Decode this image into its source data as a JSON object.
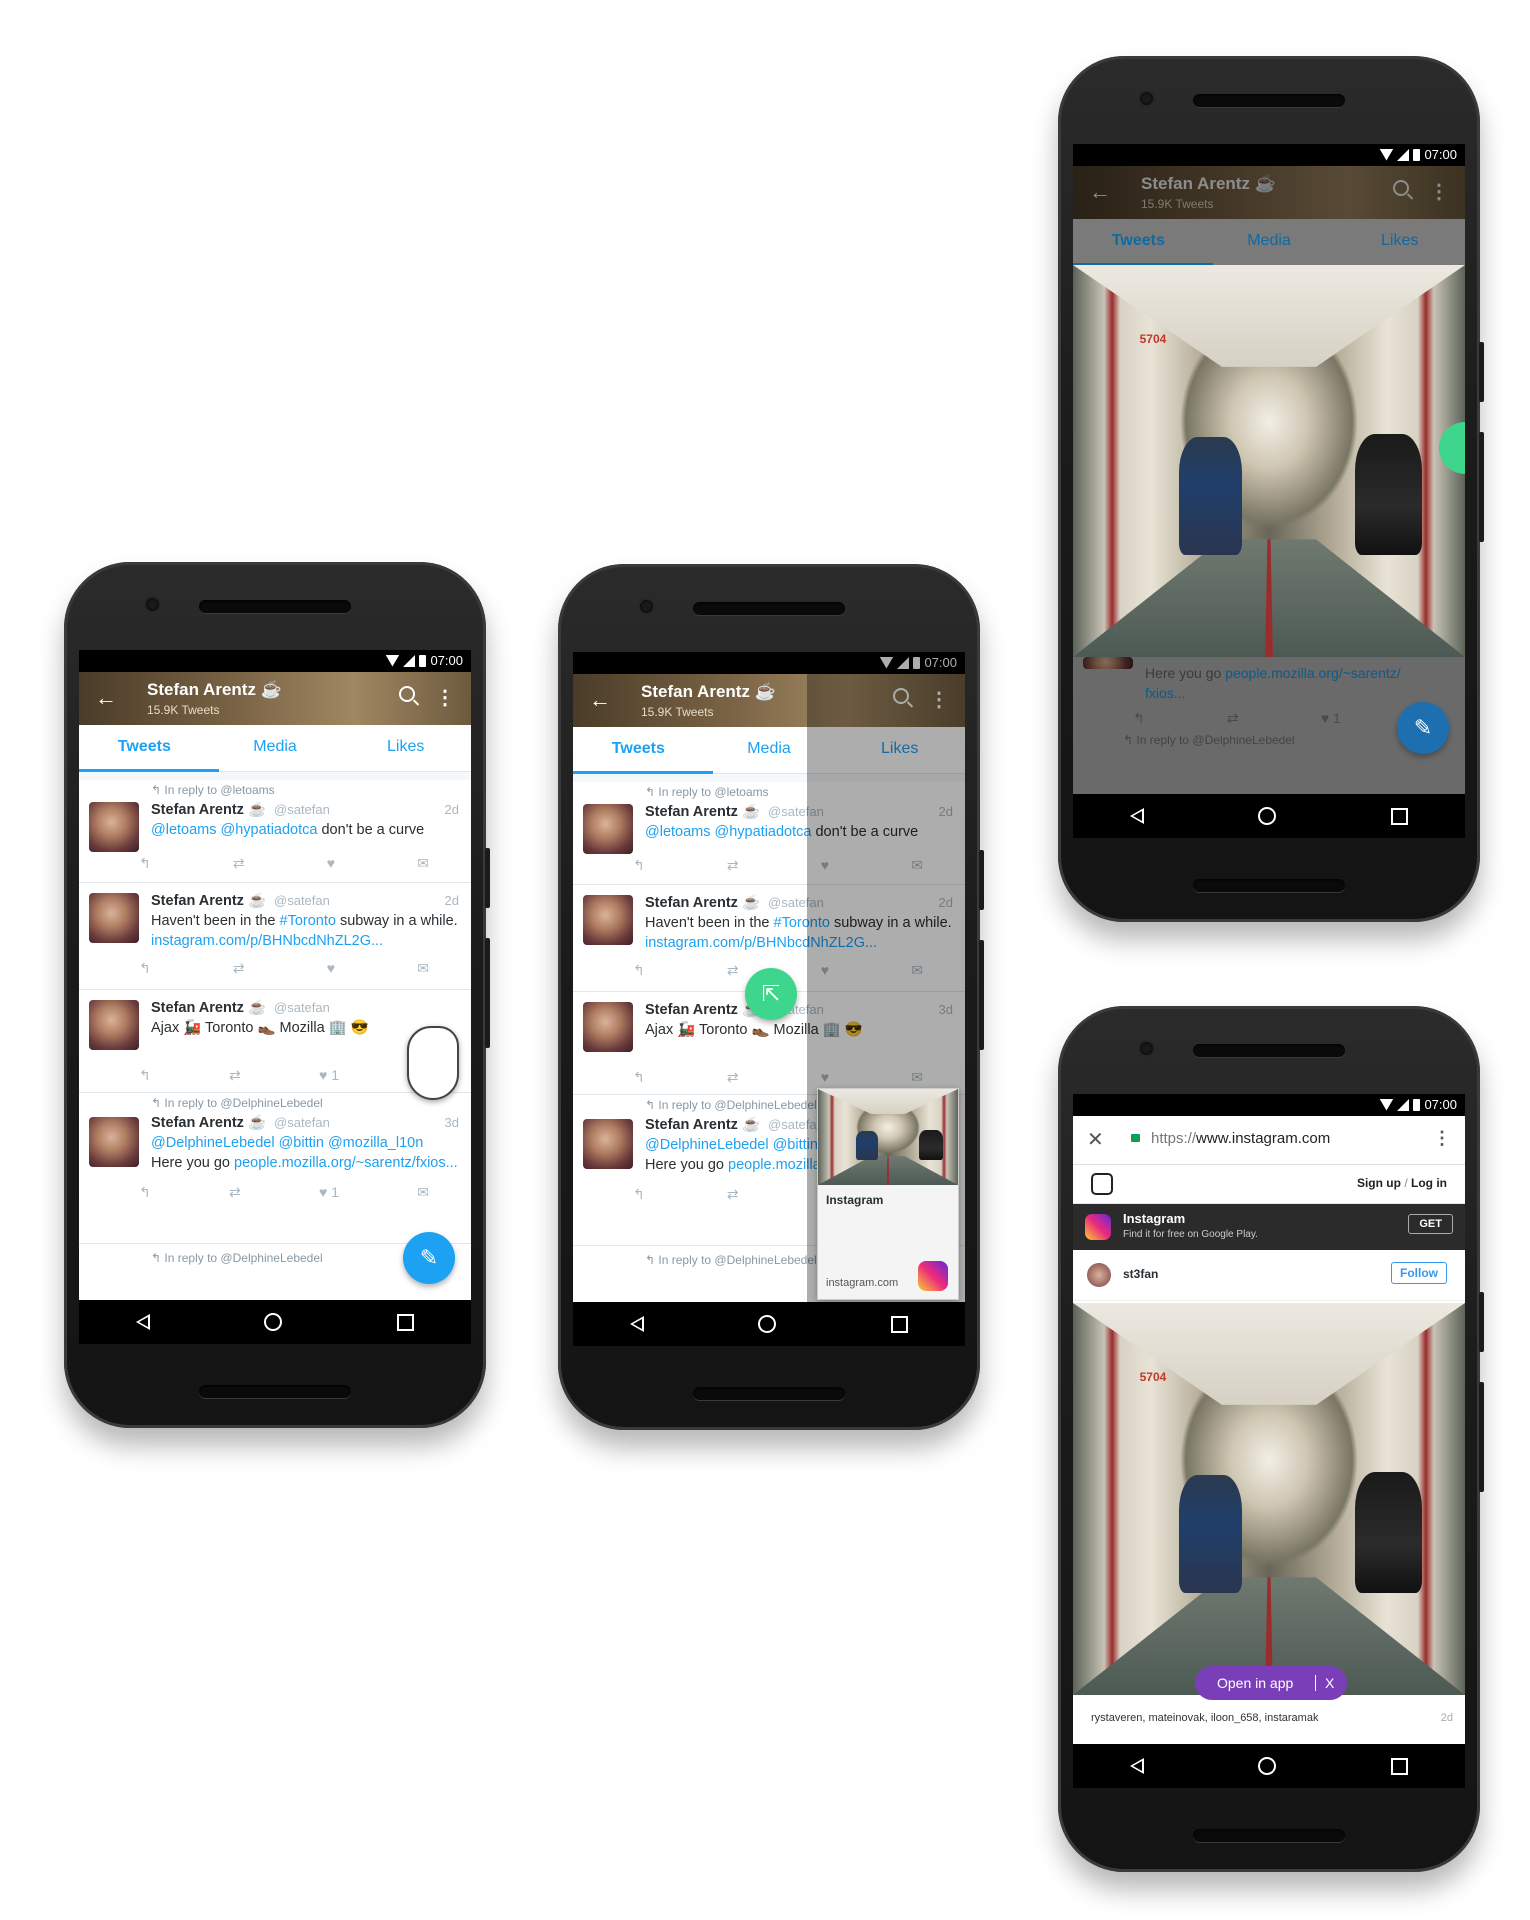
{
  "status": {
    "time": "07:00"
  },
  "profile": {
    "name": "Stefan Arentz ☕",
    "tweet_count": "15.9K Tweets",
    "tabs": [
      "Tweets",
      "Media",
      "Likes"
    ]
  },
  "tweets": [
    {
      "reply_to": "In reply to @letoams",
      "name": "Stefan Arentz ☕",
      "handle": "@satefan",
      "age": "2d",
      "text_links": "@letoams @hypatiadotca",
      "text": " don't be a curve"
    },
    {
      "reply_to": "",
      "name": "Stefan Arentz ☕",
      "handle": "@satefan",
      "age": "2d",
      "text_pre": "Haven't been in the ",
      "hashtag": "#Toronto",
      "text_mid": " subway in a while. ",
      "link": "instagram.com/p/BHNbcdNhZL2G..."
    },
    {
      "reply_to": "",
      "name": "Stefan Arentz ☕",
      "handle": "@satefan",
      "age": "",
      "text": "Ajax 🚂 Toronto 👞 Mozilla 🏢 😎",
      "likes": "1",
      "age_alt": "3d"
    },
    {
      "reply_to": "In reply to @DelphineLebedel",
      "name": "Stefan Arentz ☕",
      "handle": "@satefan",
      "age": "3d",
      "mentions": "@DelphineLebedel @bittin @mozilla_l10n",
      "text_pre": "Here you go ",
      "link": "people.mozilla.org/~sarentz/fxios...",
      "likes": "1"
    },
    {
      "reply_to": "In reply to @DelphineLebedel"
    }
  ],
  "preview": {
    "title": "Instagram",
    "domain": "instagram.com"
  },
  "photo": {
    "car_number": "5704"
  },
  "faded_tweet": {
    "text_pre": "Here you go ",
    "link": "people.mozilla.org/~sarentz/",
    "link2": "fxios...",
    "likes": "1",
    "reply_to": "In reply to @DelphineLebedel"
  },
  "browser": {
    "url_scheme": "https://",
    "url_host": "www.instagram.com"
  },
  "instagram": {
    "sign_up": "Sign up",
    "separator": "/",
    "log_in": "Log in",
    "app_name": "Instagram",
    "app_sub": "Find it for free on Google Play.",
    "get_label": "GET",
    "username": "st3fan",
    "follow_label": "Follow",
    "open_in_app": "Open in app",
    "dismiss": "X",
    "likers": "rystaveren, mateinovak, iloon_658, instaramak",
    "likers_age": "2d"
  },
  "colors": {
    "twitter_blue": "#1da1f2",
    "open_pill": "#7a3fb8",
    "green_fab": "#3dd68c"
  }
}
